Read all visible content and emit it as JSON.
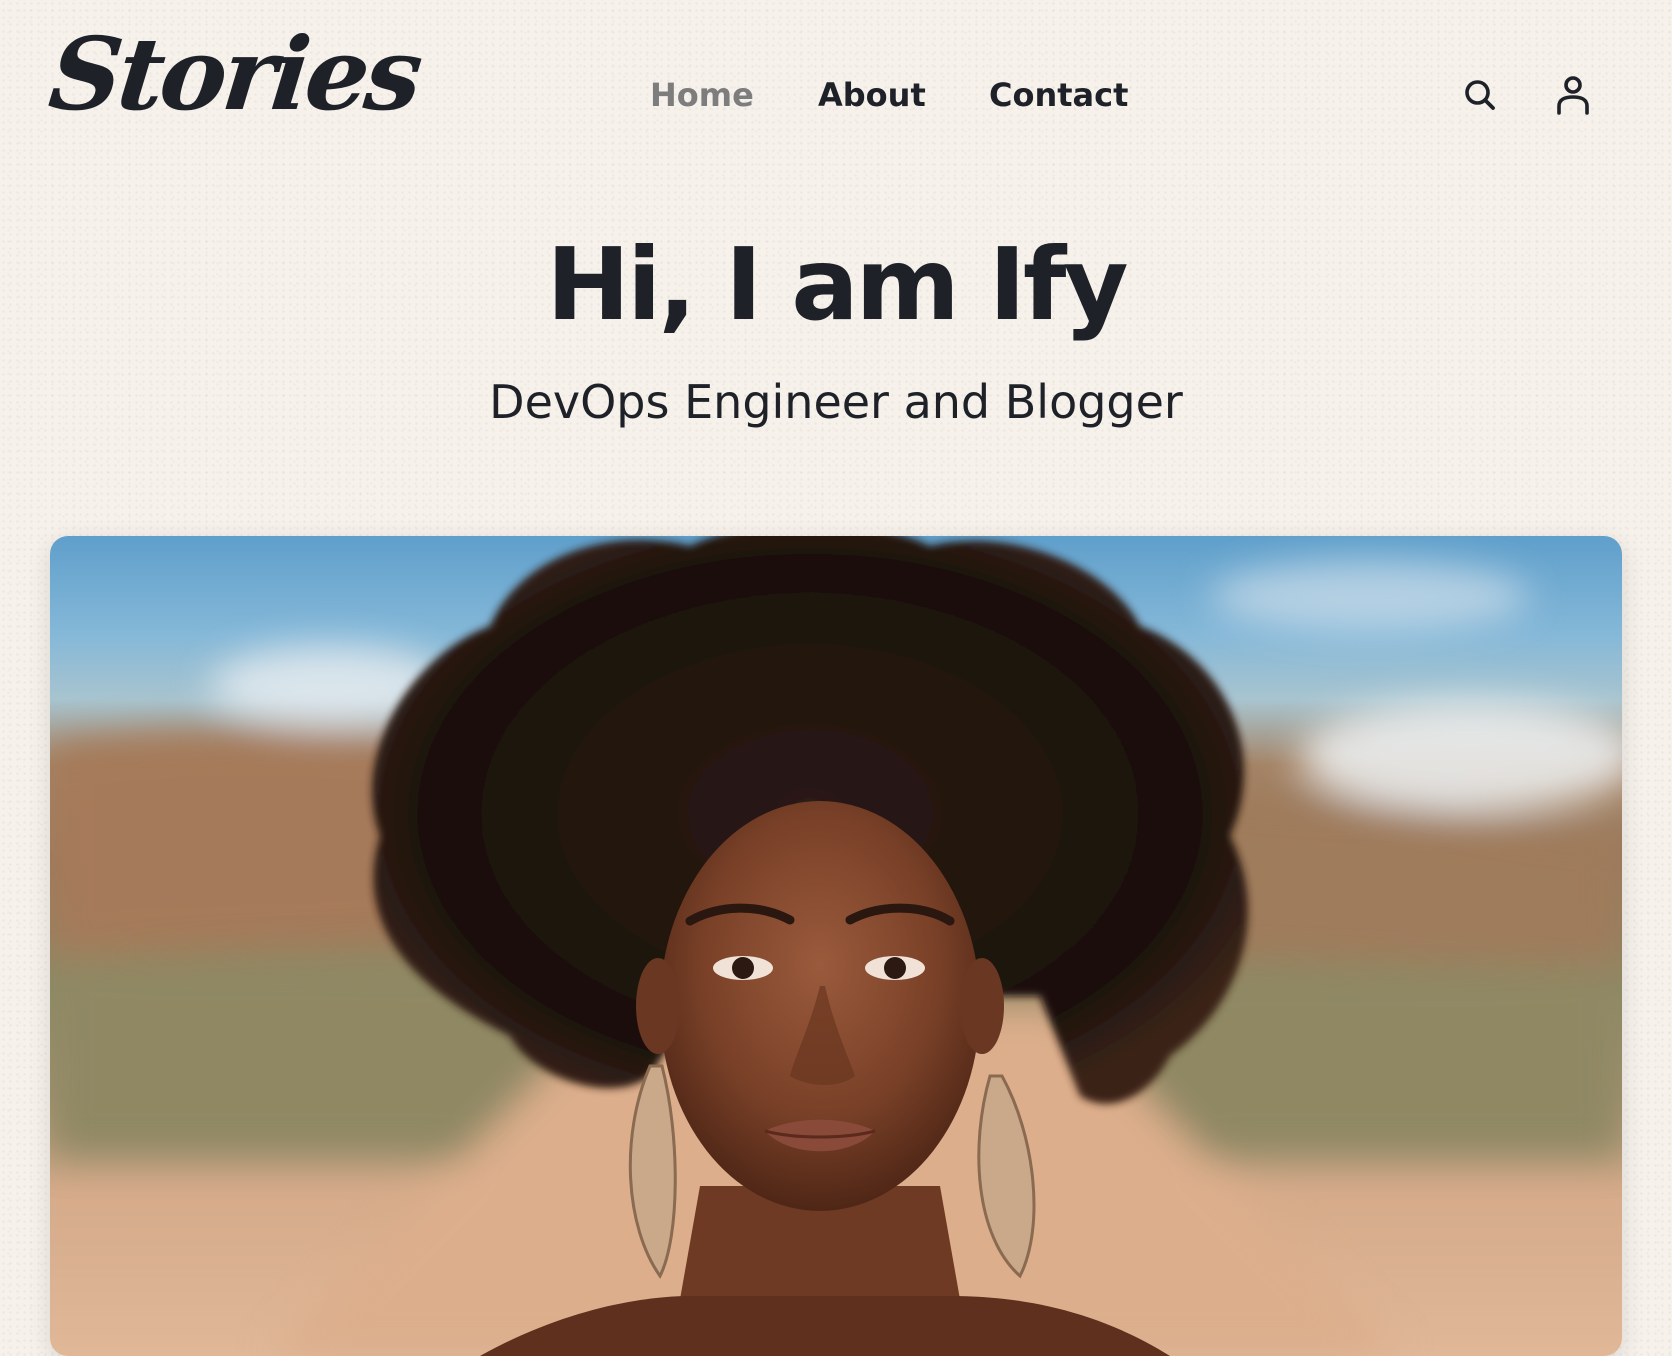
{
  "site": {
    "logo_text": "Stories"
  },
  "nav": {
    "items": [
      {
        "label": "Home",
        "active": true
      },
      {
        "label": "About",
        "active": false
      },
      {
        "label": "Contact",
        "active": false
      }
    ],
    "active_color": "#7d7d7d",
    "text_color": "#1e2228"
  },
  "header_icons": {
    "search": "search-icon",
    "account": "user-icon"
  },
  "hero": {
    "title": "Hi, I am Ify",
    "subtitle": "DevOps Engineer and Blogger"
  },
  "featured_image": {
    "icon": "portrait-photo"
  },
  "colors": {
    "background": "#f6f1eb",
    "text": "#1e2228"
  }
}
